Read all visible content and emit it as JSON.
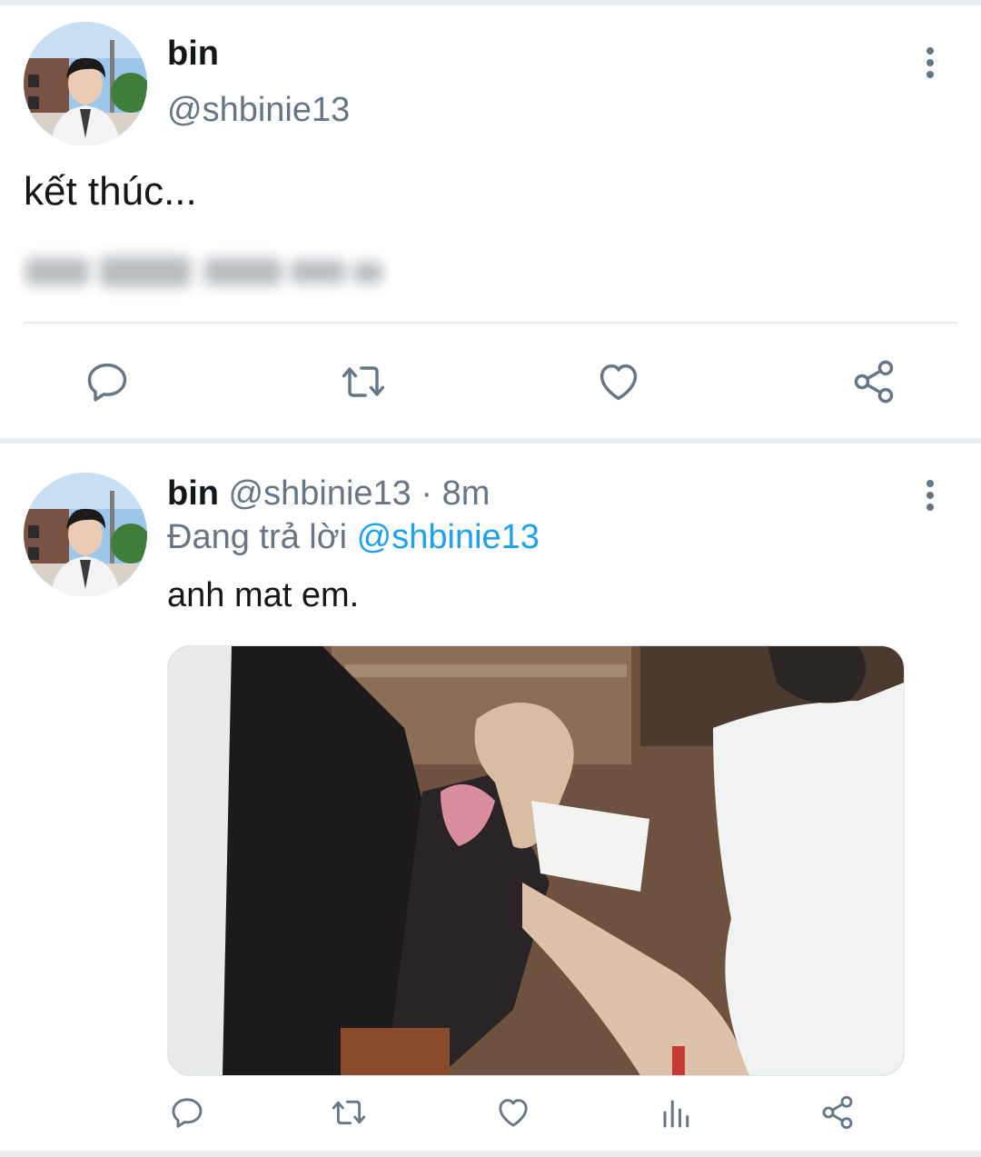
{
  "tweet1": {
    "name": "bin",
    "handle": "@shbinie13",
    "text": "kết thúc...",
    "icons": [
      "more-vertical-icon",
      "reply-icon",
      "retweet-icon",
      "like-icon",
      "share-icon"
    ]
  },
  "tweet2": {
    "name": "bin",
    "handle": "@shbinie13",
    "separator": "·",
    "time": "8m",
    "reply_prefix": "Đang trả lời",
    "reply_to": "@shbinie13",
    "text": "anh mat em.",
    "icons": [
      "more-vertical-icon",
      "reply-icon",
      "retweet-icon",
      "like-icon",
      "analytics-icon",
      "share-icon"
    ]
  },
  "colors": {
    "text": "#14171a",
    "secondary": "#657786",
    "link": "#1da1f2",
    "divider": "#e6ecf0"
  }
}
